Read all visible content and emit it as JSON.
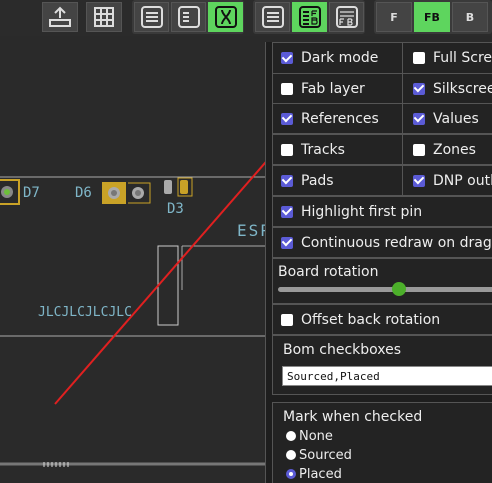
{
  "toolbar": {
    "layer_front": "F",
    "layer_front_back": "FB",
    "layer_back": "B"
  },
  "canvas": {
    "labels": {
      "d7": "D7",
      "d6": "D6",
      "d3": "D3",
      "esp": "ESP",
      "jlc": "JLCJLCJLCJLC"
    }
  },
  "settings": {
    "dark_mode": "Dark mode",
    "full_screen": "Full Screen",
    "fab_layer": "Fab layer",
    "silkscreen": "Silkscreen",
    "references": "References",
    "values": "Values",
    "tracks": "Tracks",
    "zones": "Zones",
    "pads": "Pads",
    "dnp_outlines": "DNP outlines",
    "highlight_first_pin": "Highlight first pin",
    "continuous_redraw": "Continuous redraw on drag",
    "board_rotation": "Board rotation",
    "offset_back_rotation": "Offset back rotation",
    "bom_checkboxes": "Bom checkboxes",
    "bom_checkboxes_value": "Sourced,Placed",
    "mark_when_checked": "Mark when checked",
    "mark_options": [
      "None",
      "Sourced",
      "Placed"
    ]
  },
  "colors": {
    "accent_green": "#5ed55e",
    "checkbox_blue": "#5b5bd6",
    "annotation_red": "#e02020",
    "silk_teal": "#7fb6c8",
    "pad_gold": "#c9a227"
  }
}
